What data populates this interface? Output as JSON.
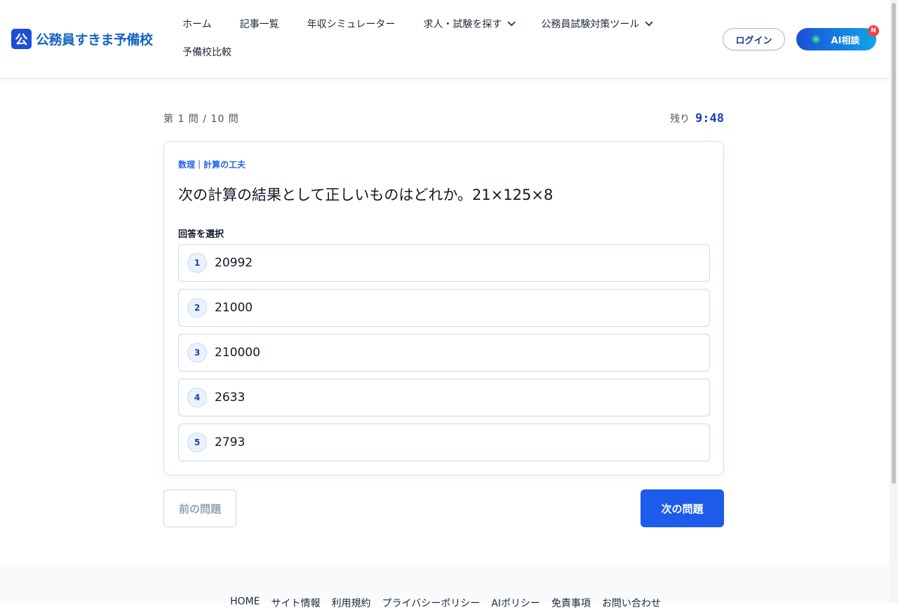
{
  "brand": {
    "mark": "公",
    "name": "公務員すきま予備校"
  },
  "nav": {
    "row1": [
      {
        "label": "ホーム",
        "dropdown": false
      },
      {
        "label": "記事一覧",
        "dropdown": false
      },
      {
        "label": "年収シミュレーター",
        "dropdown": false
      },
      {
        "label": "求人・試験を探す",
        "dropdown": true
      },
      {
        "label": "公務員試験対策ツール",
        "dropdown": true
      }
    ],
    "row2": [
      {
        "label": "予備校比較",
        "dropdown": false
      }
    ]
  },
  "header_actions": {
    "login_label": "ログイン",
    "ai_label": "AI相談",
    "ai_badge": "N"
  },
  "quiz": {
    "progress_text": "第 1 問 / 10 問",
    "timer_label": "残り",
    "timer_value": "9:48",
    "category": "数理｜計算の工夫",
    "question": "次の計算の結果として正しいものはどれか。21×125×8",
    "select_label": "回答を選択",
    "options": [
      {
        "num": "1",
        "text": "20992"
      },
      {
        "num": "2",
        "text": "21000"
      },
      {
        "num": "3",
        "text": "210000"
      },
      {
        "num": "4",
        "text": "2633"
      },
      {
        "num": "5",
        "text": "2793"
      }
    ],
    "prev_label": "前の問題",
    "next_label": "次の問題"
  },
  "footer": {
    "links": [
      "HOME",
      "サイト情報",
      "利用規約",
      "プライバシーポリシー",
      "AIポリシー",
      "免責事項",
      "お問い合わせ"
    ]
  },
  "colors": {
    "brand_blue": "#1d4ed8",
    "accent_blue": "#2563eb",
    "next_button": "#1d5bea",
    "badge_red": "#ef4444"
  }
}
